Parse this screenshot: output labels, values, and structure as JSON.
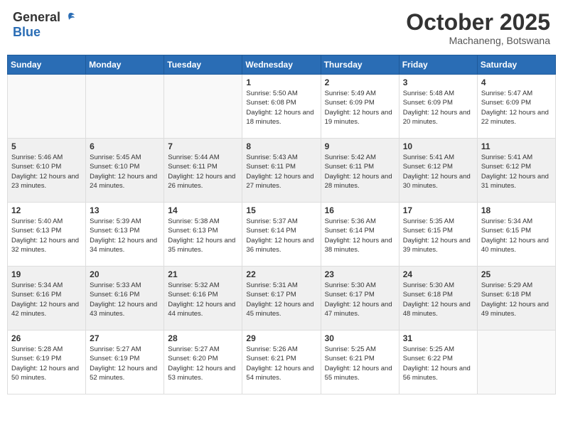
{
  "header": {
    "logo_general": "General",
    "logo_blue": "Blue",
    "month": "October 2025",
    "location": "Machaneng, Botswana"
  },
  "weekdays": [
    "Sunday",
    "Monday",
    "Tuesday",
    "Wednesday",
    "Thursday",
    "Friday",
    "Saturday"
  ],
  "weeks": [
    [
      {
        "day": "",
        "info": ""
      },
      {
        "day": "",
        "info": ""
      },
      {
        "day": "",
        "info": ""
      },
      {
        "day": "1",
        "info": "Sunrise: 5:50 AM\nSunset: 6:08 PM\nDaylight: 12 hours\nand 18 minutes."
      },
      {
        "day": "2",
        "info": "Sunrise: 5:49 AM\nSunset: 6:09 PM\nDaylight: 12 hours\nand 19 minutes."
      },
      {
        "day": "3",
        "info": "Sunrise: 5:48 AM\nSunset: 6:09 PM\nDaylight: 12 hours\nand 20 minutes."
      },
      {
        "day": "4",
        "info": "Sunrise: 5:47 AM\nSunset: 6:09 PM\nDaylight: 12 hours\nand 22 minutes."
      }
    ],
    [
      {
        "day": "5",
        "info": "Sunrise: 5:46 AM\nSunset: 6:10 PM\nDaylight: 12 hours\nand 23 minutes."
      },
      {
        "day": "6",
        "info": "Sunrise: 5:45 AM\nSunset: 6:10 PM\nDaylight: 12 hours\nand 24 minutes."
      },
      {
        "day": "7",
        "info": "Sunrise: 5:44 AM\nSunset: 6:11 PM\nDaylight: 12 hours\nand 26 minutes."
      },
      {
        "day": "8",
        "info": "Sunrise: 5:43 AM\nSunset: 6:11 PM\nDaylight: 12 hours\nand 27 minutes."
      },
      {
        "day": "9",
        "info": "Sunrise: 5:42 AM\nSunset: 6:11 PM\nDaylight: 12 hours\nand 28 minutes."
      },
      {
        "day": "10",
        "info": "Sunrise: 5:41 AM\nSunset: 6:12 PM\nDaylight: 12 hours\nand 30 minutes."
      },
      {
        "day": "11",
        "info": "Sunrise: 5:41 AM\nSunset: 6:12 PM\nDaylight: 12 hours\nand 31 minutes."
      }
    ],
    [
      {
        "day": "12",
        "info": "Sunrise: 5:40 AM\nSunset: 6:13 PM\nDaylight: 12 hours\nand 32 minutes."
      },
      {
        "day": "13",
        "info": "Sunrise: 5:39 AM\nSunset: 6:13 PM\nDaylight: 12 hours\nand 34 minutes."
      },
      {
        "day": "14",
        "info": "Sunrise: 5:38 AM\nSunset: 6:13 PM\nDaylight: 12 hours\nand 35 minutes."
      },
      {
        "day": "15",
        "info": "Sunrise: 5:37 AM\nSunset: 6:14 PM\nDaylight: 12 hours\nand 36 minutes."
      },
      {
        "day": "16",
        "info": "Sunrise: 5:36 AM\nSunset: 6:14 PM\nDaylight: 12 hours\nand 38 minutes."
      },
      {
        "day": "17",
        "info": "Sunrise: 5:35 AM\nSunset: 6:15 PM\nDaylight: 12 hours\nand 39 minutes."
      },
      {
        "day": "18",
        "info": "Sunrise: 5:34 AM\nSunset: 6:15 PM\nDaylight: 12 hours\nand 40 minutes."
      }
    ],
    [
      {
        "day": "19",
        "info": "Sunrise: 5:34 AM\nSunset: 6:16 PM\nDaylight: 12 hours\nand 42 minutes."
      },
      {
        "day": "20",
        "info": "Sunrise: 5:33 AM\nSunset: 6:16 PM\nDaylight: 12 hours\nand 43 minutes."
      },
      {
        "day": "21",
        "info": "Sunrise: 5:32 AM\nSunset: 6:16 PM\nDaylight: 12 hours\nand 44 minutes."
      },
      {
        "day": "22",
        "info": "Sunrise: 5:31 AM\nSunset: 6:17 PM\nDaylight: 12 hours\nand 45 minutes."
      },
      {
        "day": "23",
        "info": "Sunrise: 5:30 AM\nSunset: 6:17 PM\nDaylight: 12 hours\nand 47 minutes."
      },
      {
        "day": "24",
        "info": "Sunrise: 5:30 AM\nSunset: 6:18 PM\nDaylight: 12 hours\nand 48 minutes."
      },
      {
        "day": "25",
        "info": "Sunrise: 5:29 AM\nSunset: 6:18 PM\nDaylight: 12 hours\nand 49 minutes."
      }
    ],
    [
      {
        "day": "26",
        "info": "Sunrise: 5:28 AM\nSunset: 6:19 PM\nDaylight: 12 hours\nand 50 minutes."
      },
      {
        "day": "27",
        "info": "Sunrise: 5:27 AM\nSunset: 6:19 PM\nDaylight: 12 hours\nand 52 minutes."
      },
      {
        "day": "28",
        "info": "Sunrise: 5:27 AM\nSunset: 6:20 PM\nDaylight: 12 hours\nand 53 minutes."
      },
      {
        "day": "29",
        "info": "Sunrise: 5:26 AM\nSunset: 6:21 PM\nDaylight: 12 hours\nand 54 minutes."
      },
      {
        "day": "30",
        "info": "Sunrise: 5:25 AM\nSunset: 6:21 PM\nDaylight: 12 hours\nand 55 minutes."
      },
      {
        "day": "31",
        "info": "Sunrise: 5:25 AM\nSunset: 6:22 PM\nDaylight: 12 hours\nand 56 minutes."
      },
      {
        "day": "",
        "info": ""
      }
    ]
  ]
}
